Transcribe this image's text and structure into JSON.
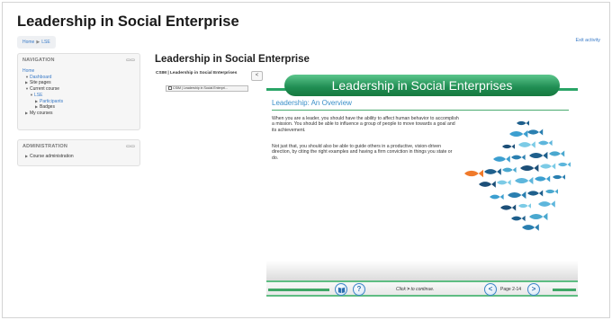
{
  "site_title": "Leadership in Social Enterprise",
  "breadcrumb": {
    "home": "Home",
    "separator": "▶",
    "course": "LSE"
  },
  "exit_activity": "Exit activity",
  "navigation": {
    "title": "NAVIGATION",
    "items": [
      {
        "label": "Home"
      },
      {
        "label": "Dashboard",
        "arrow": "▼"
      },
      {
        "label": "Site pages",
        "arrow": "▶"
      },
      {
        "label": "Current course",
        "arrow": "▼"
      },
      {
        "label": "LSE",
        "arrow": "▼"
      },
      {
        "label": "Participants",
        "arrow": "▶"
      },
      {
        "label": "Badges",
        "arrow": "▶"
      },
      {
        "label": "My courses",
        "arrow": "▶"
      }
    ]
  },
  "administration": {
    "title": "ADMINISTRATION",
    "item": "Course administration",
    "arrow": "▶"
  },
  "block_controls": "▭▭",
  "main_title": "Leadership in Social Enterprise",
  "toc": {
    "title": "CSIM | Leadership in Social Enterprises",
    "entry": "CSIM | Leadership in Social Enterpri...",
    "collapse": "<"
  },
  "slide": {
    "banner": "Leadership in Social Enterprises",
    "heading": "Leadership: An Overview",
    "para1": "When you are a leader, you should have the ability to affect human behavior to accomplish a mission. You should be able to influence a group of people to move towards a goal and its achievement.",
    "para2": "Not just that, you should also be able to guide others in a productive, vision-driven direction, by citing the right examples and having a firm conviction in things you state or do.",
    "image": "fish-school-image",
    "colors": {
      "accent_green": "#2aa567",
      "heading_blue": "#3a8fc8",
      "fish_orange": "#f07a2a"
    }
  },
  "controls": {
    "book_icon": "book-icon",
    "help": "?",
    "continue_pre": "Click",
    "continue_arrow": ">",
    "continue_post": "to continue.",
    "prev": "<",
    "page": "Page 2-14",
    "next": ">"
  }
}
